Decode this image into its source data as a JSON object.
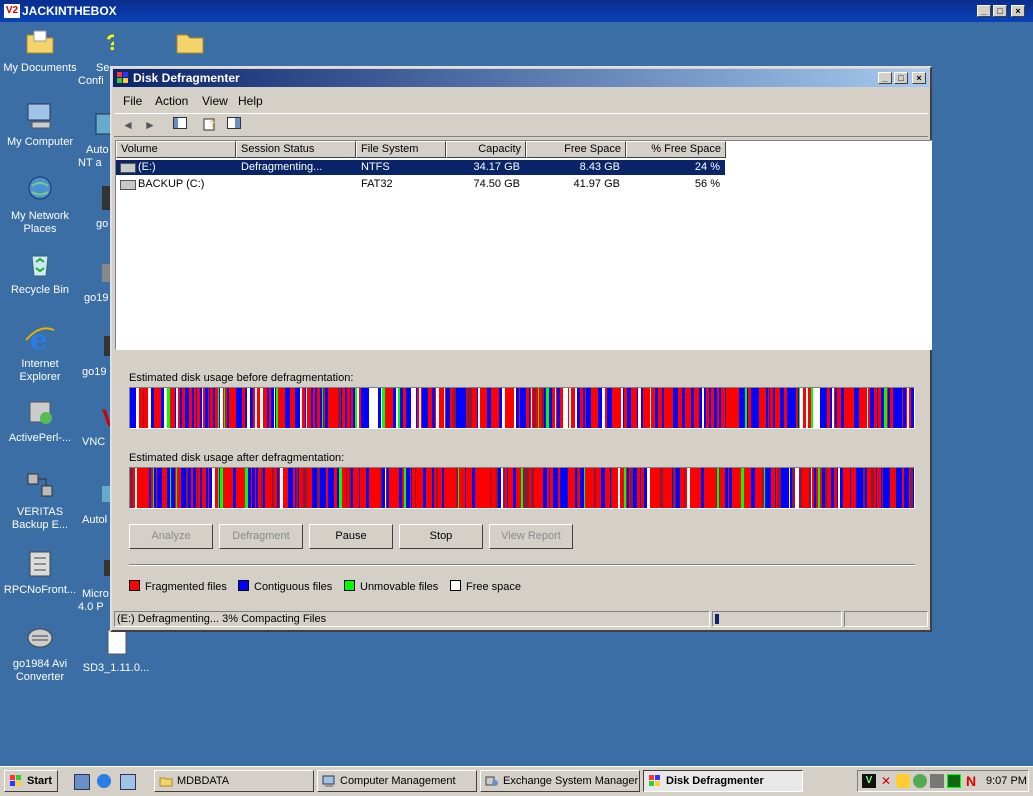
{
  "vnc": {
    "title": "JACKINTHEBOX",
    "icon": "V2"
  },
  "desktop_icons": [
    {
      "label": "My Documents",
      "icon": "folder-documents-icon"
    },
    {
      "label": "My Computer",
      "icon": "computer-icon"
    },
    {
      "label": "My Network Places",
      "icon": "network-icon"
    },
    {
      "label": "Recycle Bin",
      "icon": "recycle-bin-icon"
    },
    {
      "label": "Internet Explorer",
      "icon": "internet-explorer-icon"
    },
    {
      "label": "ActivePerl-...",
      "icon": "perl-installer-icon"
    },
    {
      "label": "VERITAS Backup E...",
      "icon": "veritas-backup-icon"
    },
    {
      "label": "RPCNoFront...",
      "icon": "rpc-icon"
    },
    {
      "label": "go1984 Avi Converter",
      "icon": "avi-converter-icon"
    }
  ],
  "desktop_icons_col2": [
    "Se Confi",
    "Auto NT a",
    "go",
    "go19",
    "go19",
    "VNC",
    "Autol",
    "Micro 4.0 P",
    "SD3_1.11.0..."
  ],
  "window": {
    "title": "Disk Defragmenter",
    "menu": [
      "File",
      "Action",
      "View",
      "Help"
    ],
    "columns": [
      "Volume",
      "Session Status",
      "File System",
      "Capacity",
      "Free Space",
      "% Free Space"
    ],
    "rows": [
      {
        "volume": "(E:)",
        "status": "Defragmenting...",
        "fs": "NTFS",
        "capacity": "34.17 GB",
        "free": "8.43 GB",
        "pct": "24 %",
        "selected": true
      },
      {
        "volume": "BACKUP (C:)",
        "status": "",
        "fs": "FAT32",
        "capacity": "74.50 GB",
        "free": "41.97 GB",
        "pct": "56 %",
        "selected": false
      }
    ],
    "before_label": "Estimated disk usage before defragmentation:",
    "after_label": "Estimated disk usage after defragmentation:",
    "buttons": [
      {
        "label": "Analyze",
        "enabled": false
      },
      {
        "label": "Defragment",
        "enabled": false
      },
      {
        "label": "Pause",
        "enabled": true
      },
      {
        "label": "Stop",
        "enabled": true
      },
      {
        "label": "View Report",
        "enabled": false
      }
    ],
    "legend": [
      {
        "label": "Fragmented files",
        "color": "#ff0000"
      },
      {
        "label": "Contiguous files",
        "color": "#0000ff"
      },
      {
        "label": "Unmovable files",
        "color": "#00ff00"
      },
      {
        "label": "Free space",
        "color": "#ffffff"
      }
    ],
    "status_text": "(E:) Defragmenting... 3%  Compacting Files",
    "progress": 0.03
  },
  "taskbar": {
    "start": "Start",
    "tasks": [
      "MDBDATA",
      "Computer Management",
      "Exchange System Manager",
      "Disk Defragmenter"
    ],
    "active_task": "Disk Defragmenter",
    "clock": "9:07 PM"
  }
}
